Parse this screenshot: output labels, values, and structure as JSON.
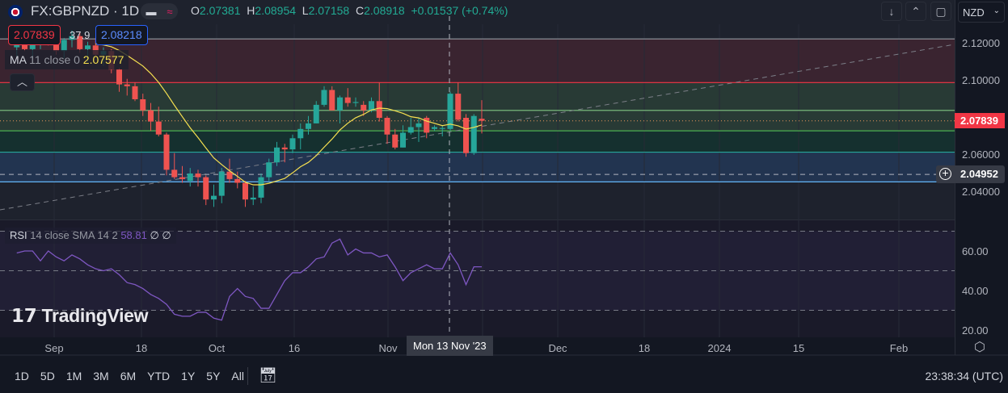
{
  "symbol": {
    "title": "FX:GBPNZD · 1D",
    "pill_icons": [
      "minus",
      "wave"
    ]
  },
  "ohlc": {
    "o_label": "O",
    "o": "2.07381",
    "h_label": "H",
    "h": "2.08954",
    "l_label": "L",
    "l": "2.07158",
    "c_label": "C",
    "c": "2.08918",
    "change": "+0.01537 (+0.74%)"
  },
  "trade": {
    "sell": "2.07839",
    "spread": "37.9",
    "buy": "2.08218"
  },
  "ma_legend": {
    "name": "MA",
    "params": "11 close 0",
    "value": "2.07577"
  },
  "rsi_legend": {
    "name": "RSI",
    "params": "14 close SMA 14 2",
    "value": "58.81",
    "extra": "∅ ∅"
  },
  "toolbar": {
    "currency": "NZD",
    "buttons": [
      "arrow-down",
      "collapse",
      "fullscreen"
    ]
  },
  "price_scale": {
    "labels": [
      "2.12000",
      "2.10000",
      "2.06000",
      "2.04000"
    ],
    "current": "2.07839",
    "crosshair": "2.04952"
  },
  "rsi_scale": {
    "labels": [
      "60.00",
      "40.00",
      "20.00"
    ]
  },
  "time_axis": {
    "labels": [
      "Sep",
      "18",
      "Oct",
      "16",
      "Nov",
      "Dec",
      "18",
      "2024",
      "15",
      "Feb"
    ],
    "crosshair": "Mon 13 Nov '23"
  },
  "watermark": "TradingView",
  "ranges": [
    "1D",
    "5D",
    "1M",
    "3M",
    "6M",
    "YTD",
    "1Y",
    "5Y",
    "All"
  ],
  "clock": "23:38:34 (UTC)",
  "colors": {
    "up": "#26a69a",
    "down": "#ef5350",
    "ma": "#f5e050",
    "rsi": "#7e57c2"
  },
  "chart_data": {
    "type": "candlestick",
    "ma_period": 11,
    "price_range": [
      2.03,
      2.13
    ],
    "ohlc": [
      [
        2.118,
        2.124,
        2.113,
        2.121
      ],
      [
        2.121,
        2.126,
        2.116,
        2.117
      ],
      [
        2.117,
        2.122,
        2.112,
        2.12
      ],
      [
        2.12,
        2.128,
        2.117,
        2.126
      ],
      [
        2.126,
        2.13,
        2.119,
        2.121
      ],
      [
        2.121,
        2.125,
        2.114,
        2.116
      ],
      [
        2.116,
        2.123,
        2.112,
        2.122
      ],
      [
        2.122,
        2.127,
        2.118,
        2.124
      ],
      [
        2.124,
        2.126,
        2.115,
        2.117
      ],
      [
        2.117,
        2.121,
        2.11,
        2.119
      ],
      [
        2.119,
        2.123,
        2.113,
        2.114
      ],
      [
        2.114,
        2.118,
        2.108,
        2.116
      ],
      [
        2.116,
        2.117,
        2.104,
        2.106
      ],
      [
        2.106,
        2.107,
        2.094,
        2.098
      ],
      [
        2.098,
        2.101,
        2.092,
        2.097
      ],
      [
        2.097,
        2.099,
        2.089,
        2.09
      ],
      [
        2.09,
        2.093,
        2.081,
        2.084
      ],
      [
        2.084,
        2.088,
        2.073,
        2.078
      ],
      [
        2.078,
        2.086,
        2.07,
        2.071
      ],
      [
        2.071,
        2.072,
        2.049,
        2.052
      ],
      [
        2.052,
        2.061,
        2.047,
        2.048
      ],
      [
        2.048,
        2.054,
        2.045,
        2.047
      ],
      [
        2.046,
        2.053,
        2.043,
        2.05
      ],
      [
        2.05,
        2.052,
        2.043,
        2.048
      ],
      [
        2.048,
        2.049,
        2.033,
        2.036
      ],
      [
        2.036,
        2.044,
        2.032,
        2.038
      ],
      [
        2.038,
        2.053,
        2.034,
        2.051
      ],
      [
        2.051,
        2.058,
        2.045,
        2.047
      ],
      [
        2.047,
        2.051,
        2.042,
        2.045
      ],
      [
        2.045,
        2.046,
        2.032,
        2.036
      ],
      [
        2.036,
        2.043,
        2.033,
        2.037
      ],
      [
        2.037,
        2.05,
        2.034,
        2.048
      ],
      [
        2.048,
        2.058,
        2.046,
        2.056
      ],
      [
        2.056,
        2.067,
        2.054,
        2.064
      ],
      [
        2.064,
        2.066,
        2.056,
        2.063
      ],
      [
        2.063,
        2.071,
        2.061,
        2.069
      ],
      [
        2.069,
        2.077,
        2.063,
        2.074
      ],
      [
        2.074,
        2.081,
        2.071,
        2.077
      ],
      [
        2.077,
        2.089,
        2.077,
        2.087
      ],
      [
        2.087,
        2.097,
        2.086,
        2.095
      ],
      [
        2.095,
        2.097,
        2.084,
        2.084
      ],
      [
        2.084,
        2.092,
        2.077,
        2.091
      ],
      [
        2.091,
        2.096,
        2.086,
        2.088
      ],
      [
        2.088,
        2.091,
        2.086,
        2.0885
      ],
      [
        2.087,
        2.089,
        2.081,
        2.084
      ],
      [
        2.084,
        2.091,
        2.083,
        2.089
      ],
      [
        2.089,
        2.099,
        2.078,
        2.08
      ],
      [
        2.08,
        2.081,
        2.066,
        2.071
      ],
      [
        2.071,
        2.074,
        2.063,
        2.064
      ],
      [
        2.064,
        2.076,
        2.064,
        2.072
      ],
      [
        2.072,
        2.08,
        2.071,
        2.075
      ],
      [
        2.075,
        2.08,
        2.067,
        2.077
      ],
      [
        2.08,
        2.081,
        2.069,
        2.072
      ],
      [
        2.074,
        2.076,
        2.073,
        2.075
      ],
      [
        2.074,
        2.076,
        2.07,
        2.0745
      ],
      [
        2.074,
        2.094,
        2.073,
        2.093
      ],
      [
        2.093,
        2.099,
        2.078,
        2.079
      ],
      [
        2.08,
        2.082,
        2.059,
        2.061
      ],
      [
        2.061,
        2.082,
        2.06,
        2.081
      ],
      [
        2.0795,
        2.0895,
        2.0716,
        2.0784
      ]
    ],
    "rsi": [
      59,
      60,
      60,
      55,
      60,
      57,
      55,
      58,
      56,
      53,
      51,
      50,
      51,
      48,
      44,
      43,
      41,
      38,
      36,
      33,
      28,
      27,
      27,
      29,
      29,
      26,
      25,
      37,
      41,
      37,
      36,
      31,
      31,
      38,
      45,
      49,
      49,
      52,
      56,
      57,
      64,
      66,
      58,
      61,
      59,
      59,
      57,
      58,
      52,
      45,
      49,
      51,
      53,
      51,
      51,
      59,
      53,
      43,
      52,
      52
    ],
    "rsi_range": [
      15,
      78
    ],
    "rsi_levels": [
      70,
      50,
      30
    ],
    "levels": [
      2.1225,
      2.099,
      2.084,
      2.073,
      2.0615,
      2.0455
    ],
    "current_price": 2.07839,
    "crosshair_price": 2.04952
  }
}
